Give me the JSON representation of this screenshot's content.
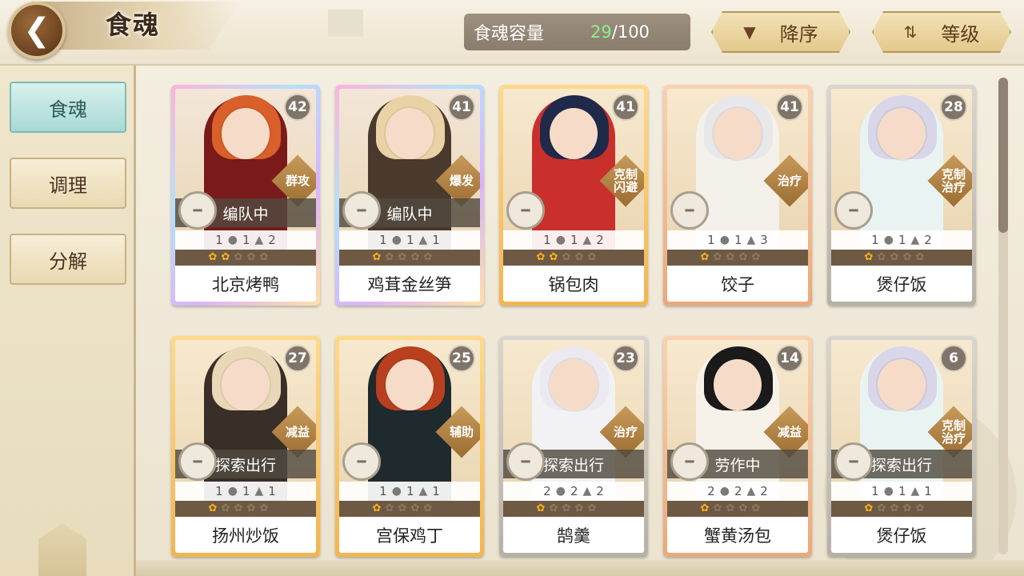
{
  "header": {
    "title": "食魂",
    "capacity_label": "食魂容量",
    "capacity_current": "29",
    "capacity_sep": "/",
    "capacity_max": "100",
    "sort_label": "降序",
    "level_label": "等级"
  },
  "sidebar": {
    "items": [
      {
        "label": "食魂",
        "active": true
      },
      {
        "label": "调理",
        "active": false
      },
      {
        "label": "分解",
        "active": false
      }
    ]
  },
  "cards": [
    {
      "name": "北京烤鸭",
      "level": "42",
      "role": "群攻",
      "status": "编队中",
      "stats": [
        "1",
        "1",
        "2"
      ],
      "flames_on": 2,
      "frame": "rainbow",
      "hair": "#d9602a",
      "outfit": "#7a1a1a"
    },
    {
      "name": "鸡茸金丝笋",
      "level": "41",
      "role": "爆发",
      "status": "编队中",
      "stats": [
        "1",
        "1",
        "1"
      ],
      "flames_on": 1,
      "frame": "rainbow",
      "hair": "#e9d3a6",
      "outfit": "#4a3a2e"
    },
    {
      "name": "锅包肉",
      "level": "41",
      "role": "克制\n闪避",
      "status": "",
      "stats": [
        "1",
        "1",
        "2"
      ],
      "flames_on": 2,
      "frame": "gold",
      "hair": "#1f2a4a",
      "outfit": "#c9302c"
    },
    {
      "name": "饺子",
      "level": "41",
      "role": "治疗",
      "status": "",
      "stats": [
        "1",
        "1",
        "3"
      ],
      "flames_on": 1,
      "frame": "rose",
      "hair": "#e8e8ea",
      "outfit": "#f4f0ea"
    },
    {
      "name": "煲仔饭",
      "level": "28",
      "role": "克制\n治疗",
      "status": "",
      "stats": [
        "1",
        "1",
        "2"
      ],
      "flames_on": 1,
      "frame": "silver",
      "hair": "#d8d6e8",
      "outfit": "#e9f4f2"
    },
    {
      "name": "扬州炒饭",
      "level": "27",
      "role": "减益",
      "status": "探索出行",
      "stats": [
        "1",
        "1",
        "1"
      ],
      "flames_on": 1,
      "frame": "gold",
      "hair": "#e8d8b8",
      "outfit": "#3a2e28"
    },
    {
      "name": "宫保鸡丁",
      "level": "25",
      "role": "辅助",
      "status": "",
      "stats": [
        "1",
        "1",
        "1"
      ],
      "flames_on": 1,
      "frame": "gold",
      "hair": "#b8401e",
      "outfit": "#1e2a2e"
    },
    {
      "name": "鹄羹",
      "level": "23",
      "role": "治疗",
      "status": "探索出行",
      "stats": [
        "2",
        "2",
        "2"
      ],
      "flames_on": 1,
      "frame": "silver",
      "hair": "#eceaf0",
      "outfit": "#f2f2f4"
    },
    {
      "name": "蟹黄汤包",
      "level": "14",
      "role": "减益",
      "status": "劳作中",
      "stats": [
        "2",
        "2",
        "2"
      ],
      "flames_on": 1,
      "frame": "rose",
      "hair": "#1a1a1a",
      "outfit": "#f6f2ea"
    },
    {
      "name": "煲仔饭",
      "level": "6",
      "role": "克制\n治疗",
      "status": "探索出行",
      "stats": [
        "1",
        "1",
        "1"
      ],
      "flames_on": 1,
      "frame": "silver",
      "hair": "#d8d6e8",
      "outfit": "#e9f4f2"
    }
  ],
  "icons": {
    "back": "chevron-left-icon",
    "sort": "triangle-down-icon",
    "level": "level-icon",
    "bowl": "bowl-icon",
    "stat": "spirit-orb-icon",
    "flame": "flame-icon"
  }
}
